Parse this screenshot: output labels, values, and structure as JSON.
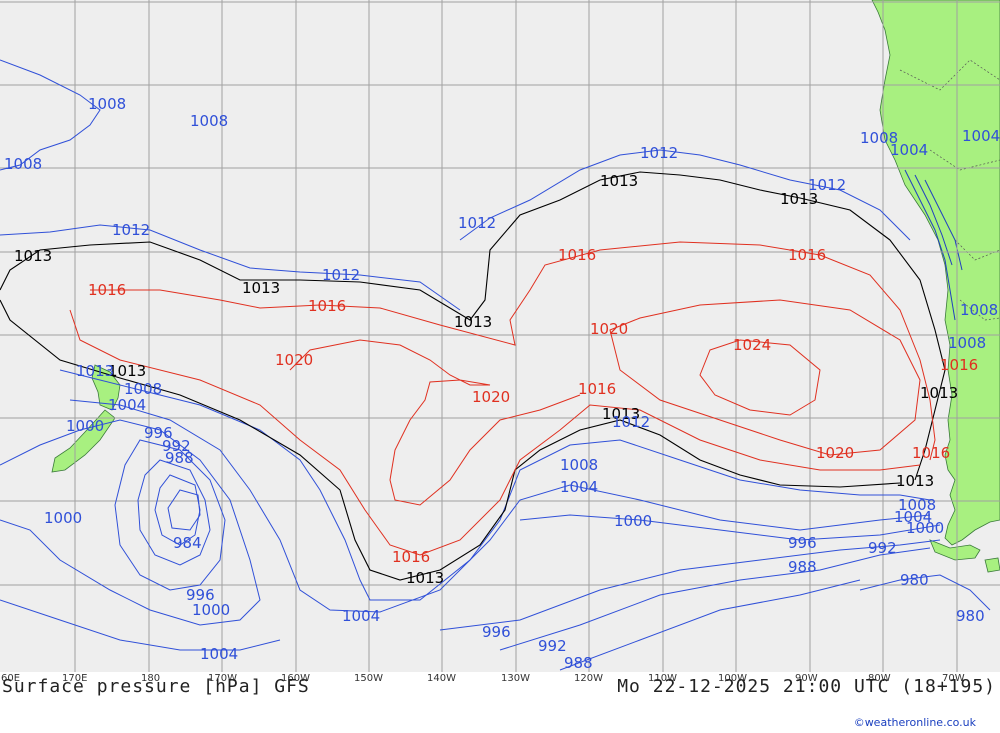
{
  "map": {
    "title_left": "Surface pressure [hPa] GFS",
    "title_right": "Mo 22-12-2025 21:00 UTC (18+195)",
    "credit": "©weatheronline.co.uk",
    "colors": {
      "ocean": "#eeeeee",
      "land": "#a8f080",
      "grid": "#a0a0a0",
      "low": "#3050d8",
      "mid": "#000000",
      "high": "#e03020"
    },
    "lon_ticks": [
      "60E",
      "170E",
      "180",
      "170W",
      "160W",
      "150W",
      "140W",
      "130W",
      "120W",
      "110W",
      "100W",
      "90W",
      "80W",
      "70W"
    ],
    "isobar_labels": [
      {
        "text": "1008",
        "cls": "low"
      },
      {
        "text": "1008",
        "cls": "low"
      },
      {
        "text": "1008",
        "cls": "low"
      },
      {
        "text": "1012",
        "cls": "low"
      },
      {
        "text": "1013",
        "cls": "mid"
      },
      {
        "text": "1016",
        "cls": "high"
      },
      {
        "text": "1013",
        "cls": "mid"
      },
      {
        "text": "1012",
        "cls": "low"
      },
      {
        "text": "1016",
        "cls": "high"
      },
      {
        "text": "1013",
        "cls": "mid"
      },
      {
        "text": "1012",
        "cls": "low"
      },
      {
        "text": "1012",
        "cls": "low"
      },
      {
        "text": "1013",
        "cls": "mid"
      },
      {
        "text": "1013",
        "cls": "mid"
      },
      {
        "text": "1012",
        "cls": "low"
      },
      {
        "text": "1016",
        "cls": "high"
      },
      {
        "text": "1016",
        "cls": "high"
      },
      {
        "text": "1020",
        "cls": "high"
      },
      {
        "text": "1024",
        "cls": "high"
      },
      {
        "text": "1020",
        "cls": "high"
      },
      {
        "text": "1020",
        "cls": "high"
      },
      {
        "text": "1016",
        "cls": "high"
      },
      {
        "text": "1013",
        "cls": "mid"
      },
      {
        "text": "1012",
        "cls": "low"
      },
      {
        "text": "1020",
        "cls": "high"
      },
      {
        "text": "1016",
        "cls": "high"
      },
      {
        "text": "1013",
        "cls": "mid"
      },
      {
        "text": "1013",
        "cls": "mid"
      },
      {
        "text": "1013",
        "cls": "mid"
      },
      {
        "text": "1008",
        "cls": "low"
      },
      {
        "text": "1004",
        "cls": "low"
      },
      {
        "text": "1000",
        "cls": "low"
      },
      {
        "text": "996",
        "cls": "low"
      },
      {
        "text": "992",
        "cls": "low"
      },
      {
        "text": "988",
        "cls": "low"
      },
      {
        "text": "984",
        "cls": "low"
      },
      {
        "text": "1000",
        "cls": "low"
      },
      {
        "text": "996",
        "cls": "low"
      },
      {
        "text": "1000",
        "cls": "low"
      },
      {
        "text": "1004",
        "cls": "low"
      },
      {
        "text": "1004",
        "cls": "low"
      },
      {
        "text": "1016",
        "cls": "high"
      },
      {
        "text": "1013",
        "cls": "mid"
      },
      {
        "text": "1008",
        "cls": "low"
      },
      {
        "text": "1004",
        "cls": "low"
      },
      {
        "text": "1000",
        "cls": "low"
      },
      {
        "text": "996",
        "cls": "low"
      },
      {
        "text": "992",
        "cls": "low"
      },
      {
        "text": "988",
        "cls": "low"
      },
      {
        "text": "996",
        "cls": "low"
      },
      {
        "text": "992",
        "cls": "low"
      },
      {
        "text": "988",
        "cls": "low"
      },
      {
        "text": "980",
        "cls": "low"
      },
      {
        "text": "980",
        "cls": "low"
      },
      {
        "text": "1008",
        "cls": "low"
      },
      {
        "text": "1004",
        "cls": "low"
      },
      {
        "text": "1000",
        "cls": "low"
      },
      {
        "text": "1004",
        "cls": "low"
      },
      {
        "text": "1008",
        "cls": "low"
      },
      {
        "text": "1008",
        "cls": "low"
      },
      {
        "text": "1008",
        "cls": "low"
      },
      {
        "text": "1004",
        "cls": "low"
      },
      {
        "text": "1013",
        "cls": "mid"
      },
      {
        "text": "1016",
        "cls": "high"
      }
    ]
  }
}
